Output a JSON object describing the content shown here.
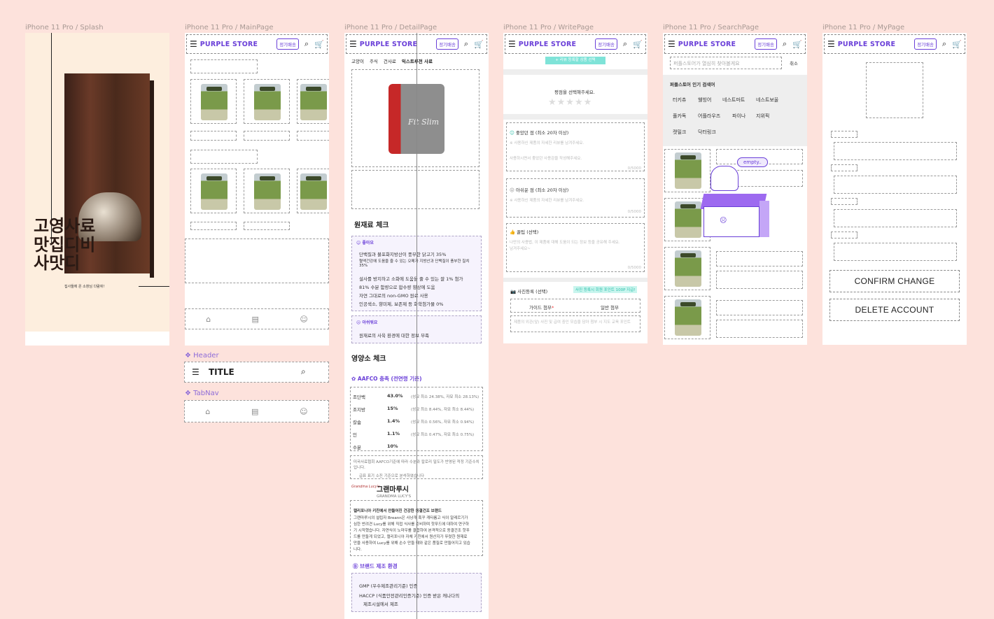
{
  "frames": {
    "splash": "iPhone 11 Pro / Splash",
    "main": "iPhone 11 Pro / MainPage",
    "detail": "iPhone 11 Pro / DetailPage",
    "write": "iPhone 11 Pro / WritePage",
    "search": "iPhone 11 Pro / SearchPage",
    "mypage": "iPhone 11 Pro / MyPage"
  },
  "header": {
    "brand": "PURPLE STORE",
    "pill": "정기배송",
    "menu_icon": "menu-icon",
    "search_icon": "search-icon",
    "cart_icon": "cart-icon"
  },
  "splash": {
    "line1": "고영사료",
    "line2": "맛집디비",
    "line3": "사맛디",
    "tagline": "집사들에 온 소창님 다람쥐!"
  },
  "components": {
    "header_label": "Header",
    "header_title": "TITLE",
    "tabnav_label": "TabNav"
  },
  "detail": {
    "breadcrumbs": [
      "고양이",
      "주식",
      "건사료",
      "익스트루전 사료"
    ],
    "product_text": "Fit Slim",
    "ingredient_title": "원재료 체크",
    "good_label": "좋아요",
    "good_items": [
      "단백질과 불포화지방산이 풍부한 닭고기 35%",
      "혈액건강에 도움을 줄 수 있는 오메가 지방산과 단백질이 풍부한 칠치 35%",
      "설사를 방지하고 소화에 도움을 줄 수 있는 쌀 1% 첨가",
      "81% 수분 함량으로 합수량 향상에 도움",
      "자연 그대로의 non-GMO 원료 사용",
      "인공색소, 향미제, 보존제 등 화학첨가물 0%"
    ],
    "bad_label": "아쉬워요",
    "bad_items": [
      "원재료의 사육 환경에 대한 정보 부족"
    ],
    "nutrient_title": "영양소 체크",
    "aafco_label": "AAFCO 충족 (전연령 기준)",
    "nutrients": [
      {
        "name": "조단백",
        "value": "43.0%",
        "note": "(성묘 최소 24.38%, 자묘 최소 28.13%)"
      },
      {
        "name": "조지방",
        "value": "15%",
        "note": "(성묘 최소 8.44%, 자묘 최소 8.44%)"
      },
      {
        "name": "칼슘",
        "value": "1.4%",
        "note": "(성묘 최소 0.56%, 자묘 최소 0.94%)"
      },
      {
        "name": "인",
        "value": "1.1%",
        "note": "(성묘 최소 0.47%, 자묘 최소 0.75%)"
      },
      {
        "name": "수분",
        "value": "10%",
        "note": ""
      }
    ],
    "nutrient_note1": "미국사료협회 AAFCO기준에 따라 수분과 칼로리 밀도가 반영된 적정 기준수치입니다.",
    "nutrient_note2": "급표 표기 소진 기준으로 분석하였습니다",
    "brand_name": "그랜마루시",
    "brand_sub": "GRANDMA LUCY'S",
    "brand_headline": "캘리포니아 키친에서 만들어진 건강한 동결건조 브랜드",
    "brand_body": [
      "그랜마루시의 설립자 Breann은 사냥개 혹꾸 캐타롬고 식이 알레르기가",
      "심한 반려견 Lucy를 위해 직접 식사를 준비하며 핫푸드에 대하여 연구하",
      "기 시작했습니다. 자연식이 노마우를 결합하여 본격적으로 동결건조 핫푸",
      "드를 만들게 되었고, 캘리포니아 자체 키친에서 원산지가 뚜렷한 원재료",
      "만을 사용하여 Lucy를 위해 손수 만들 때와 같은 품질로 만들어지고 있습",
      "니다."
    ],
    "env_label": "브랜드 제조 환경",
    "env_items": [
      "GMP (우수제조관리기준) 인증",
      "HACCP (식품안전관리인증기준) 인증 받은 캐나다의",
      "제조시설에서 제조"
    ]
  },
  "write": {
    "top_button": "+ 리뷰 등록할 상품 선택",
    "rating_label": "평점을 선택해주세요.",
    "good_title": "좋았던 점 (최소 20자 이상)",
    "good_hint1": "※ 사용하신 제품의 자세한 리뷰를 남겨주세요.",
    "good_hint2": "사용하시면서 좋았던 사용감을 작성해주세요.",
    "good_count": "0/5000",
    "bad_title": "아쉬운 점 (최소 20자 이상)",
    "bad_hint1": "※ 사용하신 제품의 자세한 리뷰를 남겨주세요.",
    "bad_count": "0/5000",
    "tip_title": "꿀팁 (선택)",
    "tip_hint": "나만의 사용법, 이 제품에 대해 도움이 되는 정보 등을 공유해 주세요.",
    "tip_hint2": "남겨주세요~",
    "tip_count": "0/5000",
    "photo_label": "사진등록 (선택)",
    "photo_badge": "사진 등록시 회원 포인트 100P 지급!",
    "guide_label": "가이드 첨부",
    "normal_label": "일반 첨부",
    "photo_note": "제품의 외관(앞) 사진 및 급여 중인 모습을 담아 첨부 시 지도 교육 포인트"
  },
  "search": {
    "placeholder": "퍼플스토어가 열심히 찾아볼게요",
    "cancel": "취소",
    "popular_title": "퍼플스토어 인기 검색어",
    "keywords": [
      "터키츄",
      "웰빙어",
      "네스트마트",
      "네스트보울",
      "풀카독",
      "어플라우즈",
      "파이나",
      "지위픽",
      "캣밀크",
      "닥터링크"
    ],
    "empty_bubble": "empty.."
  },
  "mypage": {
    "confirm": "CONFIRM CHANGE",
    "delete": "DELETE ACCOUNT"
  }
}
